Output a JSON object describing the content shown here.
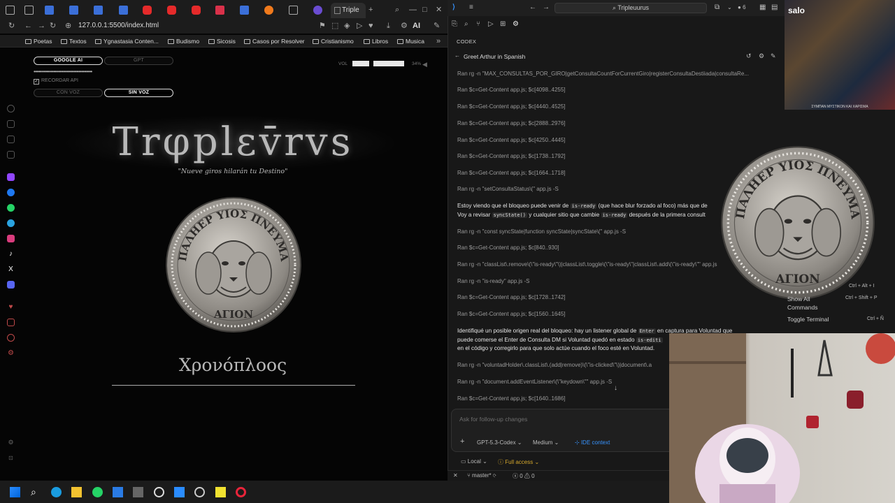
{
  "browser": {
    "active_tab_title": "Triple",
    "address": "127.0.0.1:5500/index.html",
    "ai_label": "AI",
    "bookmarks": [
      "Poetas",
      "Textos",
      "Ygnastasia Conten...",
      "Budismo",
      "Sicosis",
      "Casos por Resolver",
      "Cristianismo",
      "Libros",
      "Musica"
    ]
  },
  "app": {
    "provider_google": "GOOGLE AI",
    "provider_gpt": "GPT",
    "api_key_masked": "••••••••••••••••••••••••••••••••••••••",
    "remember_api_label": "RECORDAR API",
    "voice_on": "CON VOZ",
    "voice_off": "SIN VOZ",
    "volume_label": "VOL",
    "volume_percent": "34%",
    "title": "Trφplεv̄rvs",
    "subtitle": "\"Nueve giros hilarán tu Destino\"",
    "greek_word": "Χρονόπλοος",
    "coin_top_text": "ΠΑΛΗΕΡ ΥΙΟΣ ΠΝΕΥΜΑ",
    "coin_bottom_text": "ΑΓΙΟΝ"
  },
  "vscode": {
    "search_text": "Tripleuurus",
    "badge_count": "6",
    "panel_header": "CODEX",
    "conversation_title": "Greet Arthur in Spanish",
    "log_lines": [
      "Ran rg -n \"MAX_CONSULTAS_POR_GIRO|getConsultaCountForCurrentGiro|registerConsultaDestiiada|consultaRe...",
      "Ran $c=Get-Content app.js; $c[4098..4255]",
      "Ran $c=Get-Content app.js; $c[4440..4525]",
      "Ran $c=Get-Content app.js; $c[2888..2976]",
      "Ran $c=Get-Content app.js; $c[4250..4445]",
      "Ran $c=Get-Content app.js; $c[1738..1792]",
      "Ran $c=Get-Content app.js; $c[1664..1718]",
      "Ran rg -n \"setConsultaStatus\\(\" app.js -S"
    ],
    "para1": {
      "t1": "Estoy viendo que el bloqueo puede venir de",
      "c1": "is-ready",
      "t2": "(que hace blur forzado al foco) más que de",
      "t3": "Voy a revisar",
      "c2": "syncState()",
      "t4": "y cualquier sitio que cambie",
      "c3": "is-ready",
      "t5": "después de la primera consult"
    },
    "log_lines_2": [
      "Ran rg -n \"const syncState|function syncState|syncState\\(\" app.js -S",
      "Ran $c=Get-Content app.js; $c[840..930]",
      "Ran rg -n \"classList\\.remove\\(\\\"is-ready\\\"\\)|classList\\.toggle\\(\\\"is-ready\\\"|classList\\.add\\(\\\"is-ready\\\"\" app.js",
      "Ran rg -n \"is-ready\" app.js -S",
      "Ran $c=Get-Content app.js; $c[1728..1742]",
      "Ran $c=Get-Content app.js; $c[1560..1645]"
    ],
    "para2": {
      "t1": "Identifiqué un posible origen real del bloqueo: hay un listener global de",
      "c1": "Enter",
      "t2": "en captura para Voluntad que",
      "t3": "puede comerse el Enter de Consulta DM si Voluntad quedó en estado",
      "c2": "is-editi",
      "t4": "en el código y corregirlo para que solo actúe cuando el foco esté en Voluntad."
    },
    "log_lines_3": [
      "Ran rg -n \"voluntadHolder\\.classList\\.(add|remove)\\(\\\"is-clicked\\\"\\)|document\\.a",
      "Ran rg -n \"document.addEventListener\\(\\\"keydown\\\"\" app.js -S",
      "Ran $c=Get-Content app.js; $c[1640..1686]"
    ],
    "input_placeholder": "Ask for follow-up changes",
    "model": "GPT-5.3-Codex",
    "effort": "Medium",
    "ide_context": "IDE context",
    "location": "Local",
    "access": "Full access",
    "branch": "master*",
    "errors": "0",
    "warnings": "0"
  },
  "overlay": {
    "thumb_label": "salo",
    "thumb_footer": "ΣΥΜΠΑΝ ΜΥΣΤΙΚΟΝ ΚΑΙ ΧΑΡΙΣΜΑ",
    "kbd1": "Ctrl + Alt + I",
    "menu_show_all": "Show All",
    "menu_commands": "Commands",
    "kbd2": "Ctrl + Shift + P",
    "menu_toggle_terminal": "Toggle Terminal",
    "kbd3": "Ctrl + Ñ"
  },
  "colors": {
    "accent_blue": "#3794ff",
    "codex_gold": "#d4a72c",
    "coin_silver": "#b0aca6"
  }
}
